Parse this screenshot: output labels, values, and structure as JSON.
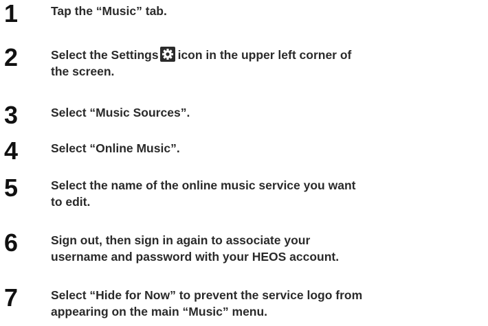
{
  "steps": [
    {
      "number": "1",
      "text": "Tap the “Music” tab."
    },
    {
      "number": "2",
      "text_before_icon": "Select the Settings",
      "icon": "settings-gear-icon",
      "text_after_icon": "icon in the upper left corner of",
      "text_line2": "the screen."
    },
    {
      "number": "3",
      "text": "Select “Music Sources”."
    },
    {
      "number": "4",
      "text": "Select “Online Music”."
    },
    {
      "number": "5",
      "text": "Select the name of the online music service you want",
      "text_line2": "to edit."
    },
    {
      "number": "6",
      "text": "Sign out, then sign in again to associate your",
      "text_line2": "username and password with your HEOS account."
    },
    {
      "number": "7",
      "text": "Select “Hide for Now” to prevent the service logo from",
      "text_line2": "appearing on the main “Music” menu."
    }
  ],
  "colors": {
    "icon_background": "#2b2b2b",
    "icon_foreground": "#ffffff",
    "text": "#2a2a2a"
  }
}
